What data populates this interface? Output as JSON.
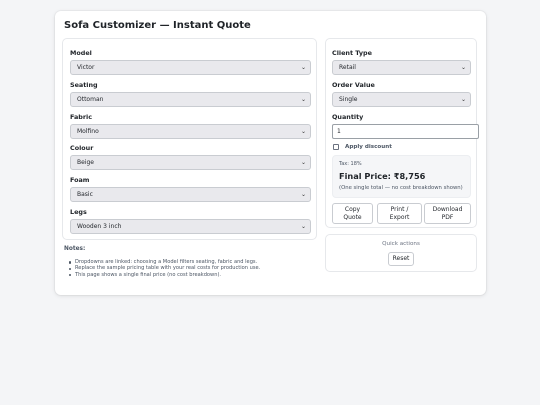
{
  "page": {
    "title": "Sofa Customizer — Instant Quote"
  },
  "left": {
    "fields": [
      {
        "label": "Model",
        "value": "Victor"
      },
      {
        "label": "Seating",
        "value": "Ottoman"
      },
      {
        "label": "Fabric",
        "value": "Molfino"
      },
      {
        "label": "Colour",
        "value": "Beige"
      },
      {
        "label": "Foam",
        "value": "Basic"
      },
      {
        "label": "Legs",
        "value": "Wooden 3 inch"
      }
    ]
  },
  "right": {
    "client_type": {
      "label": "Client Type",
      "value": "Retail"
    },
    "order_value": {
      "label": "Order Value",
      "value": "Single"
    },
    "quantity": {
      "label": "Quantity",
      "value": "1"
    },
    "discount": {
      "label": "Apply discount",
      "checked": false
    },
    "result": {
      "tax": "Tax: 18%",
      "final_price": "Final Price: ₹8,756",
      "note": "(One single total — no cost breakdown shown)"
    },
    "buttons": {
      "copy": "Copy Quote",
      "print": "Print / Export",
      "download": "Download PDF"
    }
  },
  "quick_actions": {
    "title": "Quick actions",
    "reset": "Reset"
  },
  "notes": {
    "title": "Notes:",
    "items": [
      "Dropdowns are linked: choosing a Model filters seating, fabric and legs.",
      "Replace the sample pricing table with your real costs for production use.",
      "This page shows a single final price (no cost breakdown)."
    ]
  },
  "icons": {
    "select_chevron": "chevron-down-icon"
  },
  "colors": {
    "background": "#f4f5f7",
    "card": "#ffffff",
    "select_bg": "#e9e9ed",
    "text": "#1f2328",
    "muted": "#4b5563"
  }
}
